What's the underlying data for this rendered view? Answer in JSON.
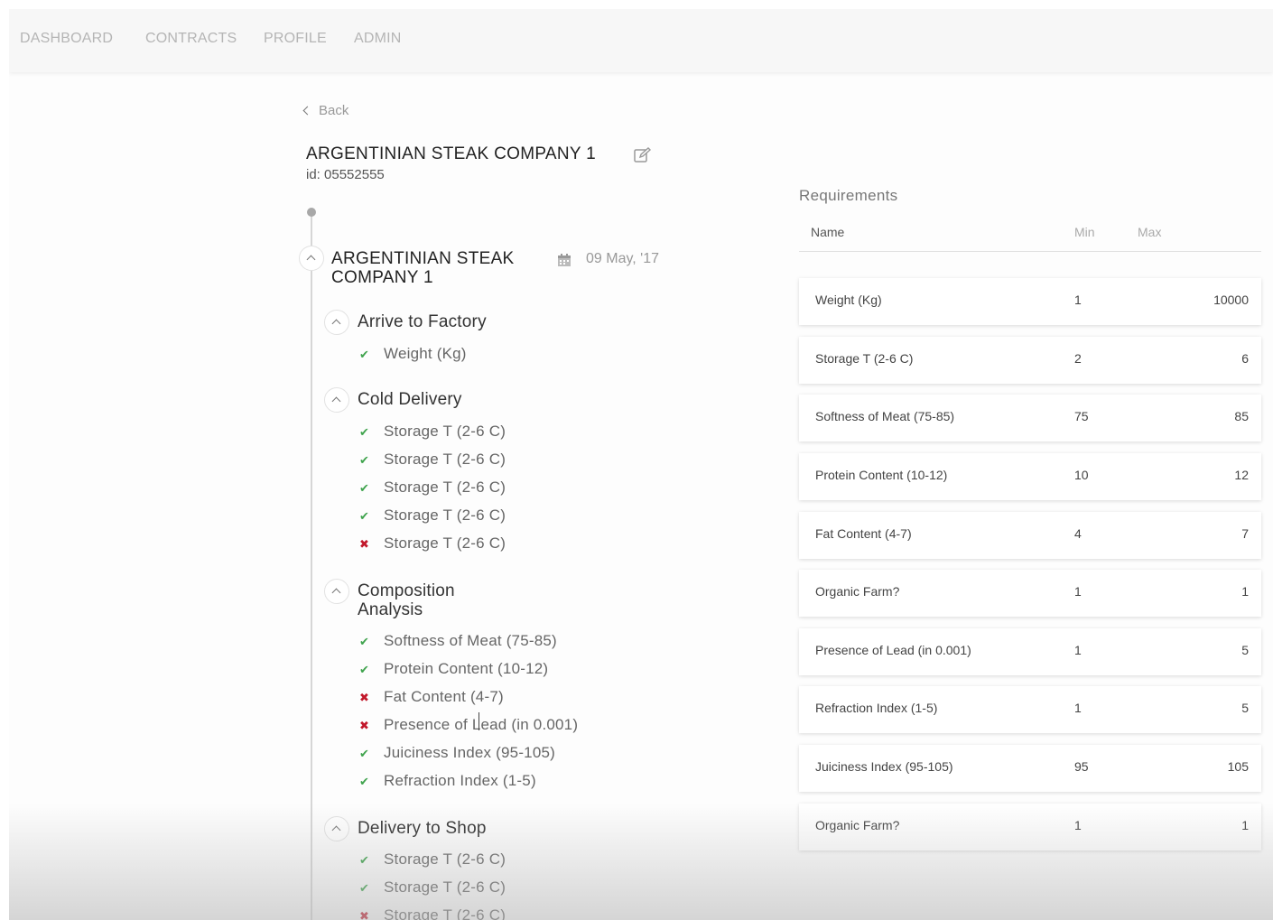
{
  "nav": {
    "items": [
      {
        "label": "DASHBOARD"
      },
      {
        "label": "CONTRACTS"
      },
      {
        "label": "PROFILE"
      },
      {
        "label": "ADMIN"
      }
    ]
  },
  "page": {
    "back_label": "Back",
    "title": "ARGENTINIAN STEAK COMPANY 1",
    "id_text": "id: 05552555"
  },
  "timeline": {
    "company": "ARGENTINIAN STEAK COMPANY 1",
    "date": "09 May, '17",
    "stages": [
      {
        "name": "Arrive to Factory",
        "checks": [
          {
            "label": "Weight (Kg)",
            "status": "ok"
          }
        ]
      },
      {
        "name": "Cold Delivery",
        "checks": [
          {
            "label": "Storage T (2-6 C)",
            "status": "ok"
          },
          {
            "label": "Storage T (2-6 C)",
            "status": "ok"
          },
          {
            "label": "Storage T (2-6 C)",
            "status": "ok"
          },
          {
            "label": "Storage T (2-6 C)",
            "status": "ok"
          },
          {
            "label": "Storage T (2-6 C)",
            "status": "fail"
          }
        ]
      },
      {
        "name": "Composition Analysis",
        "checks": [
          {
            "label": "Softness of Meat (75-85)",
            "status": "ok"
          },
          {
            "label": "Protein Content (10-12)",
            "status": "ok"
          },
          {
            "label": "Fat Content (4-7)",
            "status": "fail"
          },
          {
            "label": "Presence of Lead (in 0.001)",
            "status": "fail"
          },
          {
            "label": "Juiciness Index (95-105)",
            "status": "ok"
          },
          {
            "label": "Refraction Index (1-5)",
            "status": "ok"
          }
        ]
      },
      {
        "name": "Delivery to Shop",
        "checks": [
          {
            "label": "Storage T (2-6 C)",
            "status": "ok"
          },
          {
            "label": "Storage T (2-6 C)",
            "status": "ok"
          },
          {
            "label": "Storage T (2-6 C)",
            "status": "fail"
          }
        ]
      }
    ]
  },
  "requirements": {
    "heading": "Requirements",
    "columns": {
      "name": "Name",
      "min": "Min",
      "max": "Max"
    },
    "rows": [
      {
        "name": "Weight (Kg)",
        "min": "1",
        "max": "10000"
      },
      {
        "name": "Storage T (2-6 C)",
        "min": "2",
        "max": "6"
      },
      {
        "name": "Softness of Meat (75-85)",
        "min": "75",
        "max": "85"
      },
      {
        "name": "Protein Content (10-12)",
        "min": "10",
        "max": "12"
      },
      {
        "name": "Fat Content (4-7)",
        "min": "4",
        "max": "7"
      },
      {
        "name": "Organic Farm?",
        "min": "1",
        "max": "1"
      },
      {
        "name": "Presence of Lead (in 0.001)",
        "min": "1",
        "max": "5"
      },
      {
        "name": "Refraction Index (1-5)",
        "min": "1",
        "max": "5"
      },
      {
        "name": "Juiciness Index (95-105)",
        "min": "95",
        "max": "105"
      },
      {
        "name": "Organic Farm?",
        "min": "1",
        "max": "1"
      }
    ]
  },
  "icons": {
    "ok": "check-icon",
    "fail": "cross-icon",
    "edit": "edit-icon",
    "calendar": "calendar-icon"
  },
  "colors": {
    "ok": "#3fa34d",
    "fail": "#c2182b"
  }
}
